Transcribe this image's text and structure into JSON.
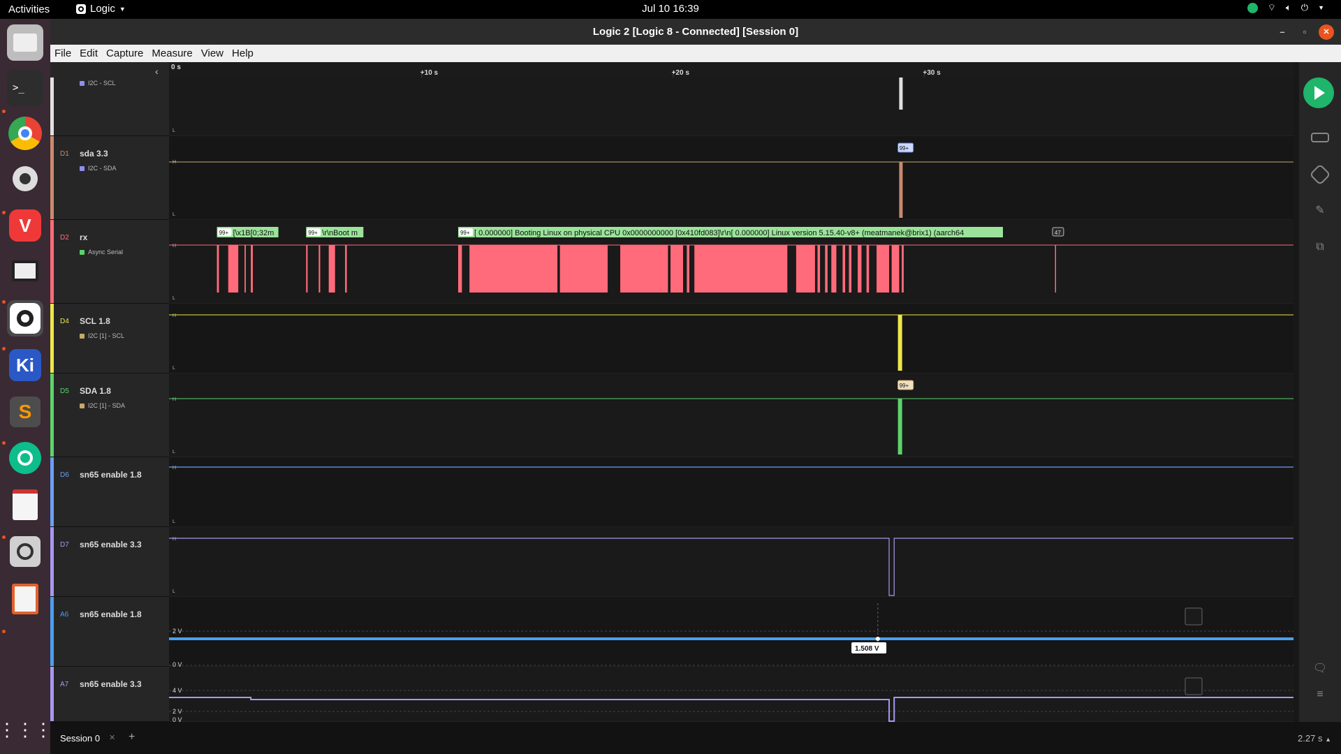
{
  "topbar": {
    "activities": "Activities",
    "app_name": "Logic",
    "clock": "Jul 10  16:39"
  },
  "window": {
    "title": "Logic 2 [Logic 8 - Connected] [Session 0]"
  },
  "menu": [
    "File",
    "Edit",
    "Capture",
    "Measure",
    "View",
    "Help"
  ],
  "timeline": {
    "labels": [
      "0 s",
      "+10 s",
      "+20 s",
      "+30 s"
    ],
    "start_s": 0,
    "end_s": 36.55
  },
  "channels": [
    {
      "id": "",
      "name": "",
      "analyzer": "I2C - SCL",
      "color": "#e0e0e0"
    },
    {
      "id": "D1",
      "name": "sda 3.3",
      "analyzer": "I2C - SDA",
      "color": "#c98a6f"
    },
    {
      "id": "D2",
      "name": "rx",
      "analyzer": "Async Serial",
      "color": "#ff6b7a"
    },
    {
      "id": "D4",
      "name": "SCL 1.8",
      "analyzer": "I2C [1] - SCL",
      "color": "#eee74a"
    },
    {
      "id": "D5",
      "name": "SDA 1.8",
      "analyzer": "I2C [1] - SDA",
      "color": "#5dd36a"
    },
    {
      "id": "D6",
      "name": "sn65 enable 1.8",
      "analyzer": "",
      "color": "#6c9ef5"
    },
    {
      "id": "D7",
      "name": "sn65 enable 3.3",
      "analyzer": "",
      "color": "#a898f0"
    },
    {
      "id": "A6",
      "name": "sn65 enable 1.8",
      "analyzer": "",
      "color": "#4a9ff0"
    },
    {
      "id": "A7",
      "name": "sn65 enable 3.3",
      "analyzer": "",
      "color": "#a898f0"
    }
  ],
  "levels": {
    "high": "H",
    "low": "L"
  },
  "analog_ticks": {
    "a6": [
      "2 V",
      "0 V"
    ],
    "a7": [
      "4 V",
      "2 V",
      "0 V"
    ]
  },
  "markers": {
    "sda33_badge": "99+",
    "sda18_badge": "99+",
    "serial_end_badge": "47",
    "voltage_readout": "1.508 V"
  },
  "serial_frames": [
    {
      "badge": "99+",
      "text": "[\\x1B[0;32m"
    },
    {
      "badge": "99+",
      "text": "\\r\\nBoot m"
    },
    {
      "badge": "99+",
      "text": "[ 0.000000] Booting Linux on physical CPU 0x0000000000 [0x410fd083]\\r\\n[ 0.000000] Linux version 5.15.40-v8+ (meatmanek@brix1) (aarch64"
    }
  ],
  "bottom": {
    "session_tab": "Session 0",
    "zoom_label": "2.27 s"
  },
  "colors": {
    "serial_fill": "#ff6b7a",
    "serial_label_bg": "#9be39b",
    "accent_green": "#1fb56b"
  }
}
